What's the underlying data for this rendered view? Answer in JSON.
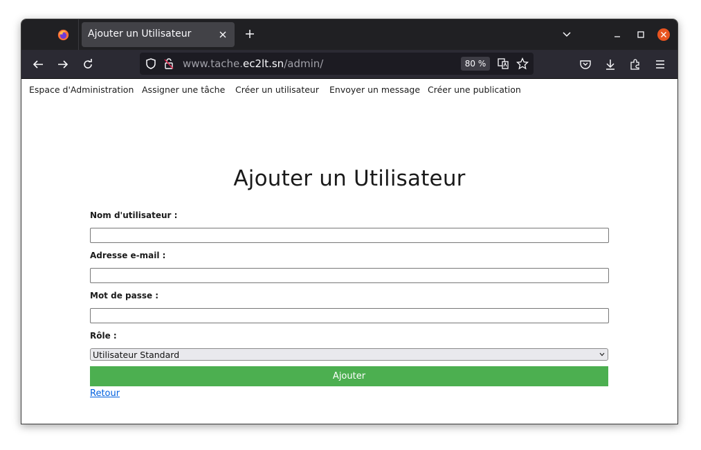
{
  "browser": {
    "tab_title": "Ajouter un Utilisateur",
    "url_prefix": "www.tache.",
    "url_host": "ec2lt.sn",
    "url_path": "/admin/",
    "zoom": "80 %"
  },
  "nav": {
    "items": [
      "Espace d'Administration",
      "Assigner une tâche",
      "Créer un utilisateur",
      "Envoyer un message",
      "Créer une publication"
    ]
  },
  "form": {
    "title": "Ajouter un Utilisateur",
    "username_label": "Nom d'utilisateur :",
    "username_value": "",
    "email_label": "Adresse e-mail :",
    "email_value": "",
    "password_label": "Mot de passe :",
    "password_value": "",
    "role_label": "Rôle :",
    "role_selected": "Utilisateur Standard",
    "submit_label": "Ajouter",
    "back_link": "Retour"
  },
  "colors": {
    "submit_button": "#4caf50",
    "link": "#0060df",
    "window_close": "#e95420",
    "tabbar": "#202023",
    "toolbar": "#2b2a33"
  }
}
